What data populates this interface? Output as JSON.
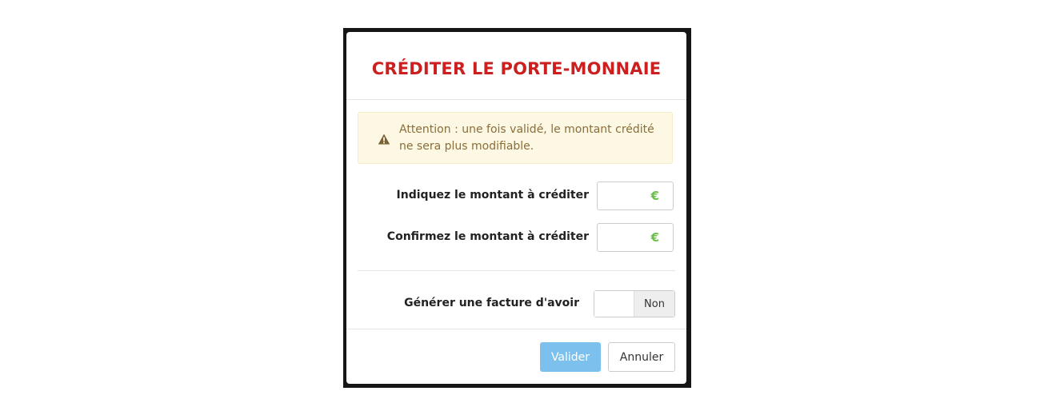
{
  "modal": {
    "title": "CRÉDITER LE PORTE-MONNAIE"
  },
  "alert": {
    "icon": "warning-icon",
    "text": "Attention : une fois validé, le montant crédité ne sera plus modifiable."
  },
  "form": {
    "amount": {
      "label": "Indiquez le montant à créditer",
      "value": "",
      "currency": "€"
    },
    "confirm_amount": {
      "label": "Confirmez le montant à créditer",
      "value": "",
      "currency": "€"
    },
    "credit_note": {
      "label": "Générer une facture d'avoir",
      "state": "Non"
    }
  },
  "footer": {
    "validate_label": "Valider",
    "cancel_label": "Annuler"
  },
  "colors": {
    "title": "#cc1f1f",
    "alert_bg": "#fcf8e3",
    "alert_text": "#8a6d3b",
    "currency": "#6cc04a",
    "primary_button": "#7cc1ed"
  }
}
